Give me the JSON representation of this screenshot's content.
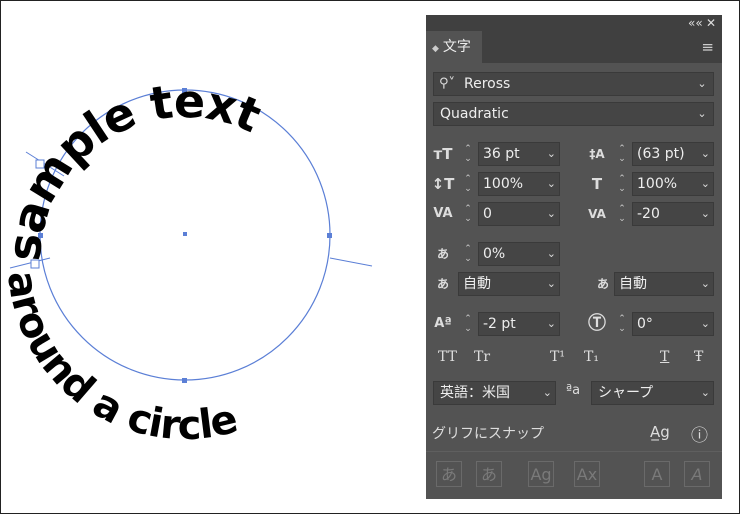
{
  "artwork": {
    "top_text": "sample text",
    "bottom_text": "around a circle"
  },
  "panel": {
    "collapse_icon": "««",
    "close_icon": "✕",
    "tab_label": "文字",
    "menu_icon": "≡",
    "font_family": "Reross",
    "font_style": "Quadratic",
    "font_size": "36 pt",
    "leading": "(63 pt)",
    "vertical_scale": "100%",
    "horizontal_scale": "100%",
    "kerning": "0",
    "tracking": "-20",
    "tsume": "0%",
    "aki_left": "自動",
    "aki_right": "自動",
    "baseline_shift": "-2 pt",
    "rotation": "0°",
    "language": "英語：米国",
    "antialias": "シャープ",
    "glyph_snap_label": "グリフにスナップ",
    "text_buttons": [
      "TT",
      "Tr",
      "T¹",
      "T₁",
      "T",
      "Ŧ"
    ],
    "bottom_icons": [
      "あ",
      "あ",
      "Ag",
      "Ax",
      "A",
      "A"
    ]
  }
}
